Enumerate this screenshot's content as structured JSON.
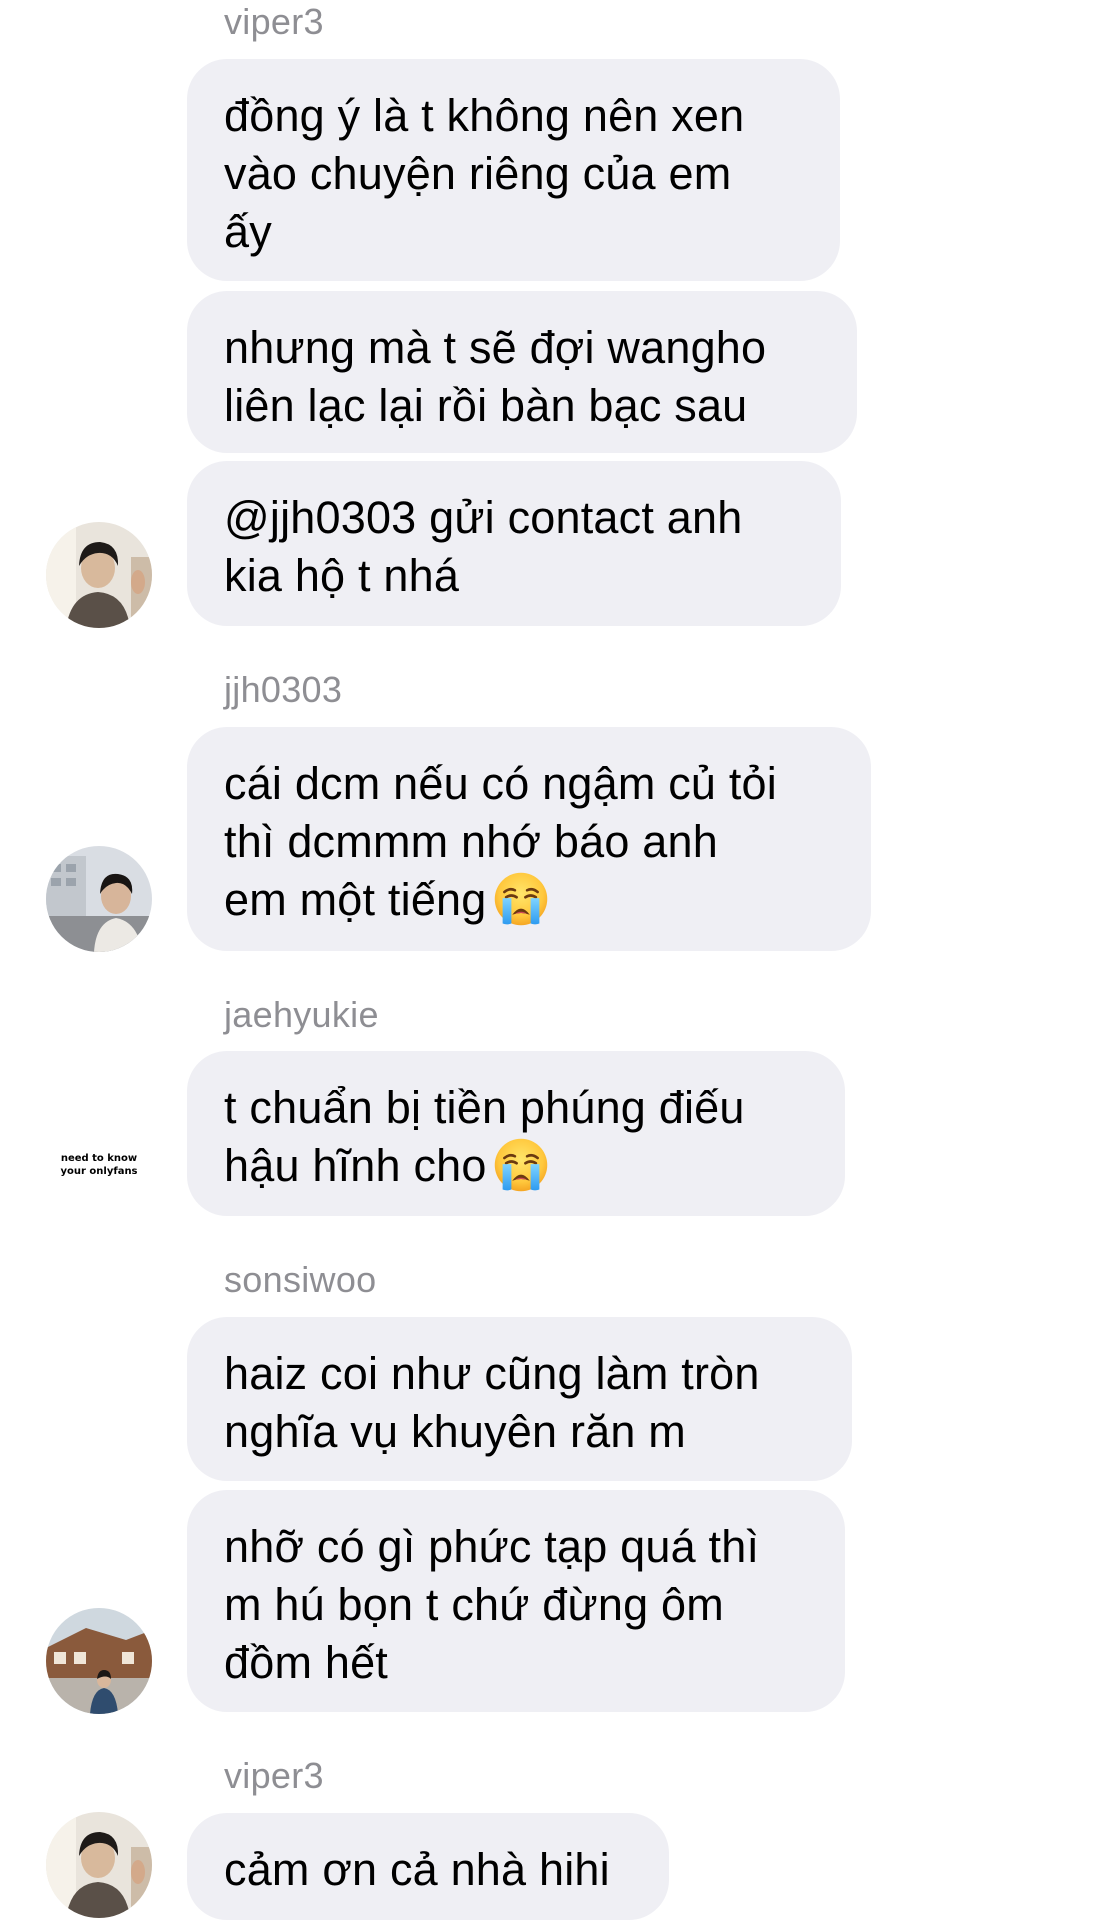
{
  "messages": [
    {
      "username": "viper3",
      "bubbles": [
        {
          "lines": [
            "đồng ý là t không nên xen",
            "vào chuyện riêng của em",
            "ấy"
          ]
        },
        {
          "lines": [
            "nhưng mà t sẽ đợi wangho",
            "liên lạc lại rồi bàn bạc sau"
          ]
        },
        {
          "lines": [
            "@jjh0303 gửi contact anh",
            "kia hộ t nhá"
          ]
        }
      ]
    },
    {
      "username": "jjh0303",
      "bubbles": [
        {
          "lines": [
            "cái dcm nếu có ngậm củ tỏi",
            "thì dcmmm nhớ báo anh",
            "em một tiếng"
          ],
          "emoji": "crying-face-emoji"
        }
      ]
    },
    {
      "username": "jaehyukie",
      "avatar_text": [
        "need to know",
        "your onlyfans"
      ],
      "bubbles": [
        {
          "lines": [
            "t chuẩn bị tiền phúng điếu",
            "hậu hĩnh cho"
          ],
          "emoji": "crying-face-emoji"
        }
      ]
    },
    {
      "username": "sonsiwoo",
      "bubbles": [
        {
          "lines": [
            "haiz coi như cũng làm tròn",
            "nghĩa vụ khuyên răn m"
          ]
        },
        {
          "lines": [
            "nhỡ có gì phức tạp quá thì",
            "m hú bọn t chứ đừng ôm",
            "đồm hết"
          ]
        }
      ]
    },
    {
      "username": "viper3",
      "bubbles": [
        {
          "lines": [
            "cảm ơn cả nhà hihi"
          ]
        }
      ]
    }
  ],
  "colors": {
    "bubble_background": "#efeff4",
    "username_text": "#8e8e93",
    "message_text": "#000000"
  }
}
